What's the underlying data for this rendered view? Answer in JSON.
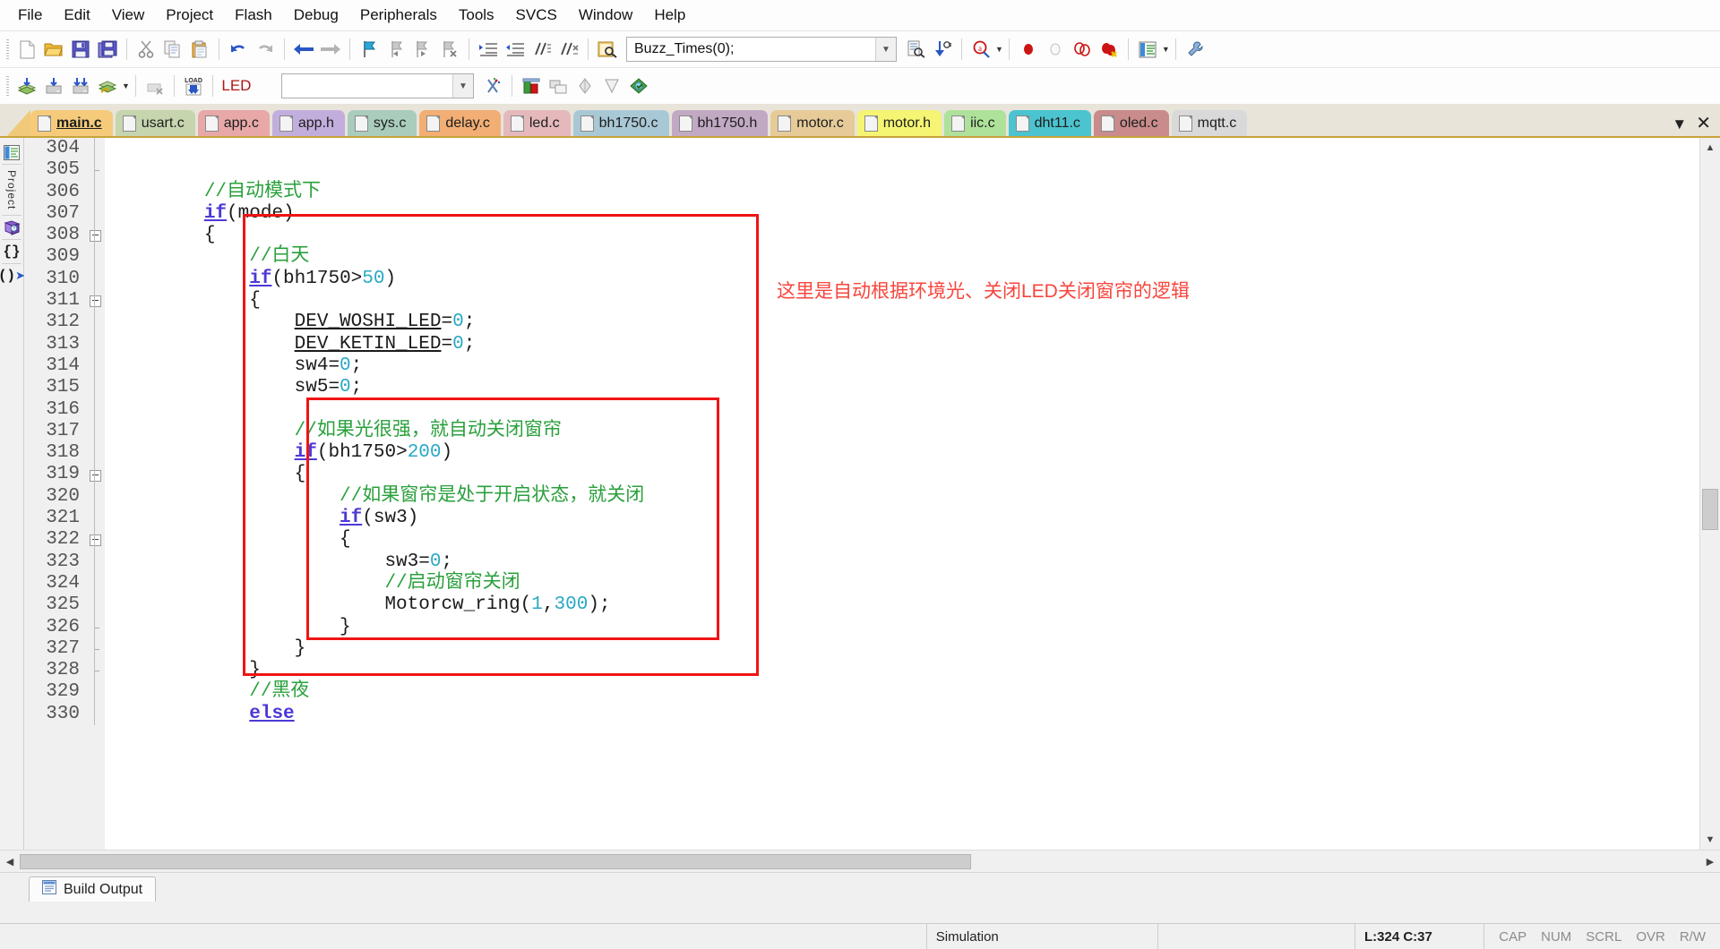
{
  "app": {
    "title": "Keil uVision - main.c"
  },
  "menubar": {
    "items": [
      {
        "label": "File",
        "name": "menu-file"
      },
      {
        "label": "Edit",
        "name": "menu-edit"
      },
      {
        "label": "View",
        "name": "menu-view"
      },
      {
        "label": "Project",
        "name": "menu-project"
      },
      {
        "label": "Flash",
        "name": "menu-flash"
      },
      {
        "label": "Debug",
        "name": "menu-debug"
      },
      {
        "label": "Peripherals",
        "name": "menu-peripherals"
      },
      {
        "label": "Tools",
        "name": "menu-tools"
      },
      {
        "label": "SVCS",
        "name": "menu-svcs"
      },
      {
        "label": "Window",
        "name": "menu-window"
      },
      {
        "label": "Help",
        "name": "menu-help"
      }
    ]
  },
  "toolbar1": {
    "icons": [
      "new-file-icon",
      "open-folder-icon",
      "save-icon",
      "save-all-icon",
      "cut-icon",
      "copy-icon",
      "paste-icon",
      "undo-icon",
      "redo-icon",
      "navigate-back-icon",
      "navigate-forward-icon",
      "bookmark-toggle-icon",
      "bookmark-prev-icon",
      "bookmark-next-icon",
      "bookmark-clear-icon",
      "indent-increase-icon",
      "indent-decrease-icon",
      "comment-lines-icon",
      "uncomment-lines-icon",
      "find-in-files-icon"
    ],
    "find_value": "Buzz_Times(0);",
    "find_placeholder": "",
    "right_icons": [
      "find-dropdown-icon",
      "browse-symbol-icon",
      "find-next-icon",
      "incremental-find-icon",
      "breakpoint-insert-icon",
      "breakpoint-disable-icon",
      "breakpoint-disable-all-icon",
      "breakpoint-kill-all-icon",
      "manage-windows-icon",
      "configure-tools-icon"
    ]
  },
  "toolbar2": {
    "icons": [
      "build-target-icon",
      "translate-file-icon",
      "build-icon",
      "rebuild-all-icon",
      "batch-build-icon",
      "download-to-flash-icon"
    ],
    "target_value": "LED",
    "right_icons": [
      "target-options-icon",
      "start-debug-icon",
      "manage-project-items-icon",
      "books-icon",
      "source-browser-icon",
      "configuration-wizard-icon",
      "multi-project-icon"
    ]
  },
  "tabs": {
    "items": [
      {
        "label": "main.c",
        "color": "#f5cb7b",
        "active": true
      },
      {
        "label": "usart.c",
        "color": "#c6d5ae",
        "active": false
      },
      {
        "label": "app.c",
        "color": "#e8a8a8",
        "active": false
      },
      {
        "label": "app.h",
        "color": "#c2aedd",
        "active": false
      },
      {
        "label": "sys.c",
        "color": "#a9ccbd",
        "active": false
      },
      {
        "label": "delay.c",
        "color": "#f2ae74",
        "active": false
      },
      {
        "label": "led.c",
        "color": "#e5b9bc",
        "active": false
      },
      {
        "label": "bh1750.c",
        "color": "#a9c8d6",
        "active": false
      },
      {
        "label": "bh1750.h",
        "color": "#c1a9c4",
        "active": false
      },
      {
        "label": "motor.c",
        "color": "#e6cb99",
        "active": false
      },
      {
        "label": "motor.h",
        "color": "#f5f573",
        "active": false
      },
      {
        "label": "iic.c",
        "color": "#aee29a",
        "active": false
      },
      {
        "label": "dht11.c",
        "color": "#4bc4cf",
        "active": false
      },
      {
        "label": "oled.c",
        "color": "#c98b8b",
        "active": false
      },
      {
        "label": "mqtt.c",
        "color": "#d9d9d9",
        "active": false
      }
    ],
    "scroll_icon": "tab-list-dropdown-icon",
    "close_icon": "close-tab-icon"
  },
  "leftbar": {
    "project_icon": "project-window-icon",
    "project_label": "Project",
    "books_icon": "books-window-icon",
    "functions_icon": "functions-window-icon",
    "templates_icon": "templates-window-icon"
  },
  "editor": {
    "first_line": 304,
    "lines": [
      {
        "n": 304,
        "fold": "",
        "text": ""
      },
      {
        "n": 305,
        "fold": "tick",
        "text": ""
      },
      {
        "n": 306,
        "fold": "",
        "text": "        //自动模式下"
      },
      {
        "n": 307,
        "fold": "",
        "text": "        if(mode)"
      },
      {
        "n": 308,
        "fold": "box",
        "text": "        {"
      },
      {
        "n": 309,
        "fold": "",
        "text": "            //白天"
      },
      {
        "n": 310,
        "fold": "",
        "text": "            if(bh1750>50)"
      },
      {
        "n": 311,
        "fold": "box",
        "text": "            {"
      },
      {
        "n": 312,
        "fold": "",
        "text": "                DEV_WOSHI_LED=0;"
      },
      {
        "n": 313,
        "fold": "",
        "text": "                DEV_KETIN_LED=0;"
      },
      {
        "n": 314,
        "fold": "",
        "text": "                sw4=0;"
      },
      {
        "n": 315,
        "fold": "",
        "text": "                sw5=0;"
      },
      {
        "n": 316,
        "fold": "",
        "text": ""
      },
      {
        "n": 317,
        "fold": "",
        "text": "                //如果光很强，就自动关闭窗帘"
      },
      {
        "n": 318,
        "fold": "",
        "text": "                if(bh1750>200)"
      },
      {
        "n": 319,
        "fold": "box",
        "text": "                {"
      },
      {
        "n": 320,
        "fold": "",
        "text": "                    //如果窗帘是处于开启状态，就关闭"
      },
      {
        "n": 321,
        "fold": "",
        "text": "                    if(sw3)"
      },
      {
        "n": 322,
        "fold": "box",
        "text": "                    {"
      },
      {
        "n": 323,
        "fold": "",
        "text": "                        sw3=0;"
      },
      {
        "n": 324,
        "fold": "",
        "text": "                        //启动窗帘关闭"
      },
      {
        "n": 325,
        "fold": "",
        "text": "                        Motorcw_ring(1,300);"
      },
      {
        "n": 326,
        "fold": "tick",
        "text": "                    }"
      },
      {
        "n": 327,
        "fold": "tick",
        "text": "                }"
      },
      {
        "n": 328,
        "fold": "tick",
        "text": "            }"
      },
      {
        "n": 329,
        "fold": "",
        "text": "            //黑夜"
      },
      {
        "n": 330,
        "fold": "",
        "text": "            else"
      }
    ],
    "annotation": {
      "text": "这里是自动根据环境光、关闭LED关闭窗帘的逻辑",
      "color": "#f8453c"
    },
    "highlight_color": "#f01414"
  },
  "build_panel": {
    "tab_label": "Build Output",
    "tab_icon": "build-output-icon"
  },
  "statusbar": {
    "message": "",
    "mode": "Simulation",
    "cursor": "L:324 C:37",
    "indicators": [
      "CAP",
      "NUM",
      "SCRL",
      "OVR",
      "R/W"
    ]
  }
}
